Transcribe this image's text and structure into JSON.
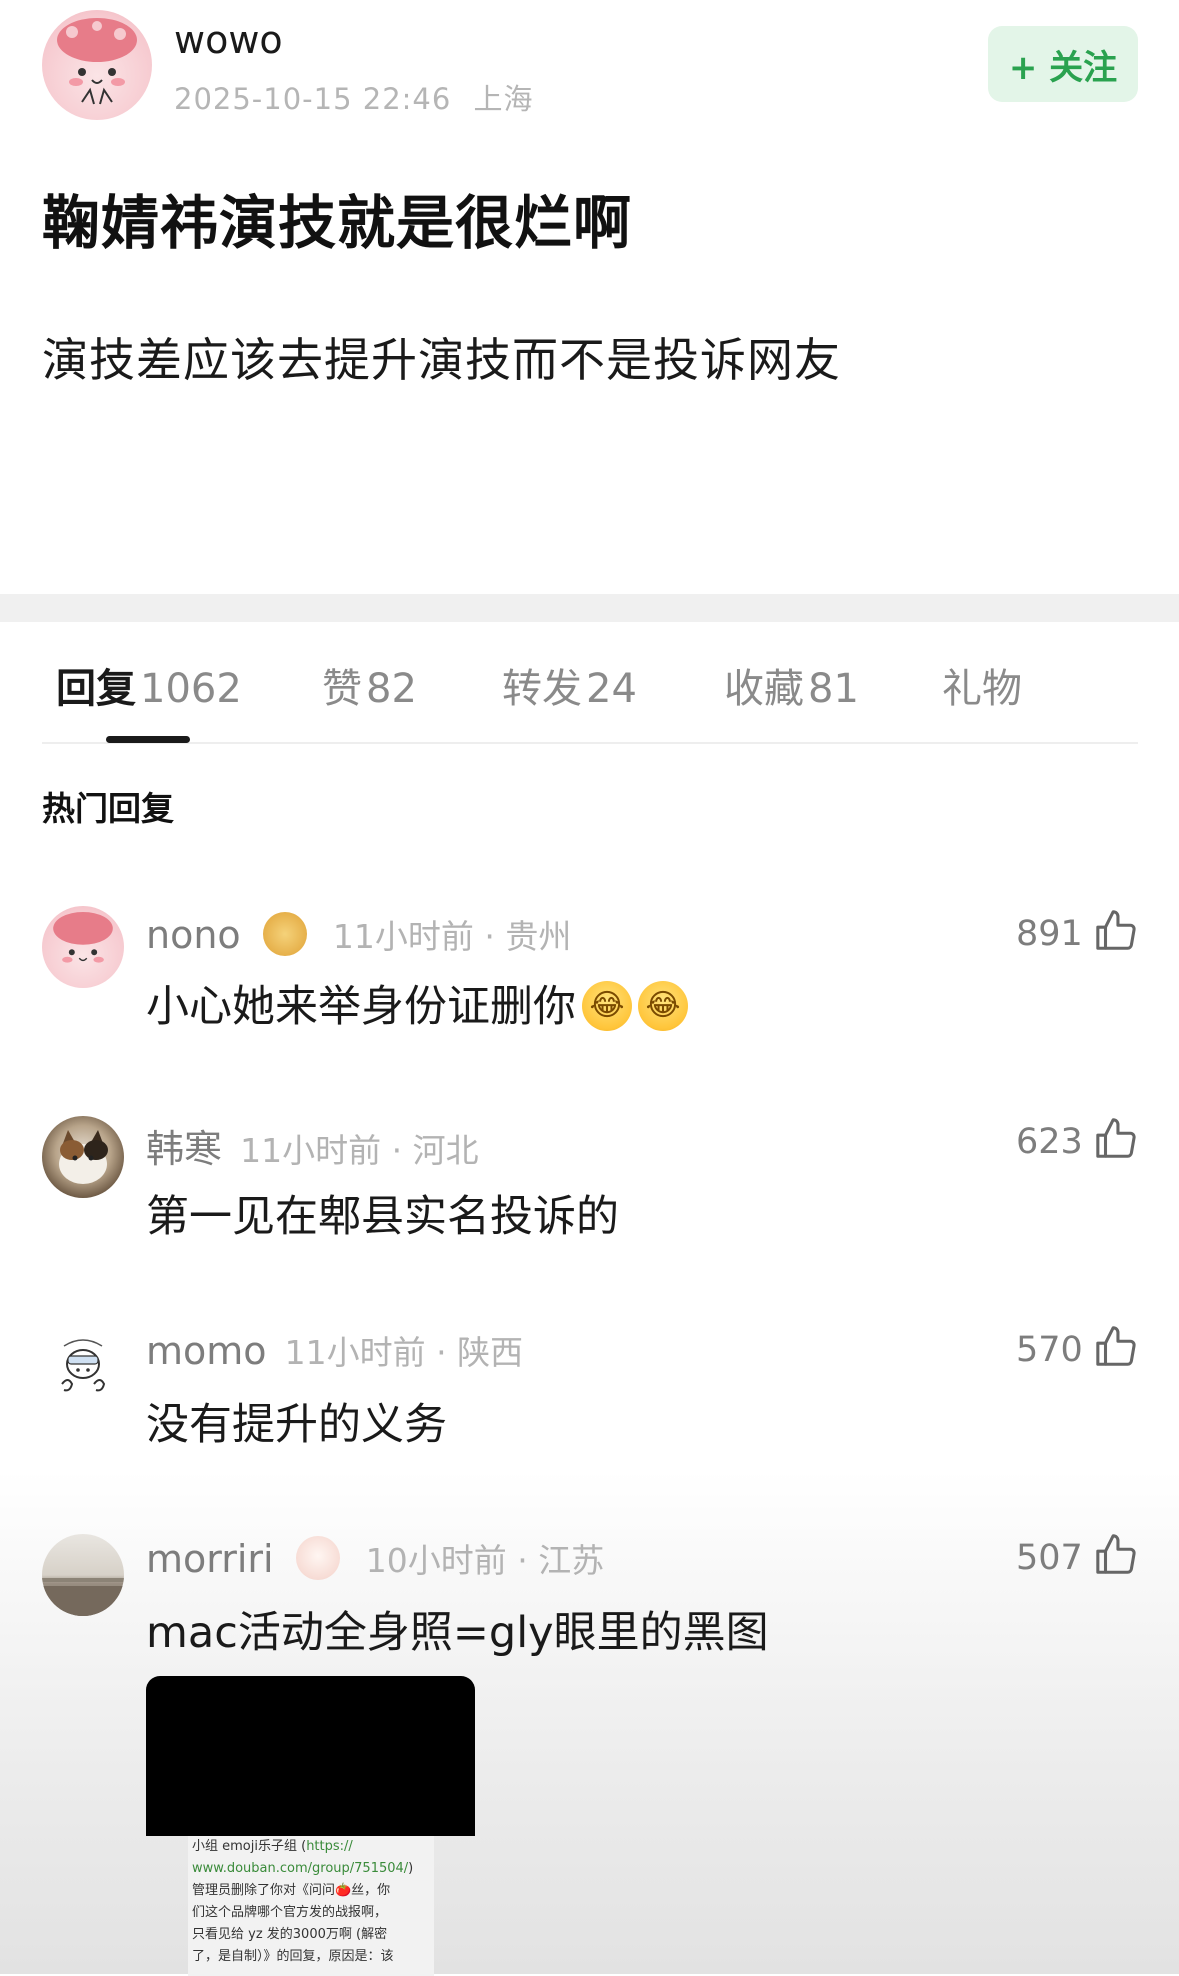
{
  "author": {
    "name": "wowo",
    "time": "2025-10-15 22:46",
    "location": "上海",
    "follow_label": "+ 关注"
  },
  "post": {
    "title": "鞠婧祎演技就是很烂啊",
    "content": "演技差应该去提升演技而不是投诉网友"
  },
  "tabs": [
    {
      "label": "回复",
      "count": "1062",
      "active": true
    },
    {
      "label": "赞",
      "count": "82"
    },
    {
      "label": "转发",
      "count": "24"
    },
    {
      "label": "收藏",
      "count": "81"
    },
    {
      "label": "礼物",
      "count": ""
    }
  ],
  "section_title": "热门回复",
  "comments": [
    {
      "name": "nono",
      "meta": "11小时前 · 贵州",
      "text": "小心她来举身份证删你",
      "likes": "891",
      "badge": "lantern"
    },
    {
      "name": "韩寒",
      "meta": "11小时前 · 河北",
      "text": "第一见在郫县实名投诉的",
      "likes": "623"
    },
    {
      "name": "momo",
      "meta": "11小时前 · 陕西",
      "text": "没有提升的义务",
      "likes": "570"
    },
    {
      "name": "morriri",
      "meta": "10小时前 · 江苏",
      "text": "mac活动全身照=gly眼里的黑图",
      "likes": "507",
      "badge": "rabbit"
    }
  ],
  "screenshot_text": {
    "line1_prefix": "小组 emoji乐子组 (",
    "line1_link": "https://",
    "line2_link": "www.douban.com/group/751504/",
    "line2_suffix": ")",
    "line3": "管理员删除了你对《问问🍅丝，你",
    "line4": "们这个品牌哪个官方发的战报啊，",
    "line5": "只看见给 yz 发的3000万啊 (解密",
    "line6": "了，是自制）》的回复，原因是：该"
  },
  "colors": {
    "follow_green": "#2aa24f",
    "follow_bg": "#e3f5e8",
    "meta_gray": "#b3b3b3"
  }
}
